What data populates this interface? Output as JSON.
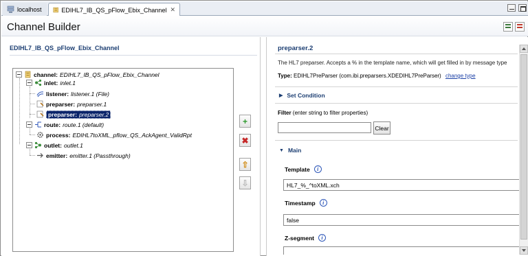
{
  "tabs": [
    {
      "label": "localhost"
    },
    {
      "label": "EDIHL7_IB_QS_pFlow_Ebix_Channel"
    }
  ],
  "header": {
    "title": "Channel Builder"
  },
  "left": {
    "heading": "EDIHL7_IB_QS_pFlow_Ebix_Channel",
    "tree": [
      {
        "key": "channel:",
        "value": "EDIHL7_IB_QS_pFlow_Ebix_Channel"
      },
      {
        "key": "inlet:",
        "value": "inlet.1"
      },
      {
        "key": "listener:",
        "value": "listener.1 (File)"
      },
      {
        "key": "preparser:",
        "value": "preparser.1"
      },
      {
        "key": "preparser:",
        "value": "preparser.2"
      },
      {
        "key": "route:",
        "value": "route.1 (default)"
      },
      {
        "key": "process:",
        "value": "EDIHL7toXML_pflow_QS_AckAgent_ValidRpt"
      },
      {
        "key": "outlet:",
        "value": "outlet.1"
      },
      {
        "key": "emitter:",
        "value": "emitter.1 (Passthrough)"
      }
    ]
  },
  "right": {
    "title": "preparser.2",
    "description": "The HL7 preparser. Accepts a % in the template name, which will get filled in by message type",
    "type_label": "Type:",
    "type_value": "EDIHL7PreParser (com.ibi.preparsers.XDEDIHL7PreParser)",
    "change_type": "change type",
    "set_condition": "Set Condition",
    "filter_label": "Filter",
    "filter_hint": "(enter string to filter properties)",
    "filter_value": "",
    "clear_label": "Clear",
    "main_label": "Main",
    "properties": [
      {
        "label": "Template",
        "value": "HL7_%_^toXML.xch"
      },
      {
        "label": "Timestamp",
        "value": "false"
      },
      {
        "label": "Z-segment",
        "value": ""
      }
    ],
    "info_glyph": "i"
  },
  "buttons": {
    "add": "+",
    "delete": "✖",
    "up": "⇧",
    "down": "⇩"
  },
  "colors": {
    "accent": "#1c3e72",
    "selection": "#0a246a",
    "link": "#1a3fa6"
  }
}
